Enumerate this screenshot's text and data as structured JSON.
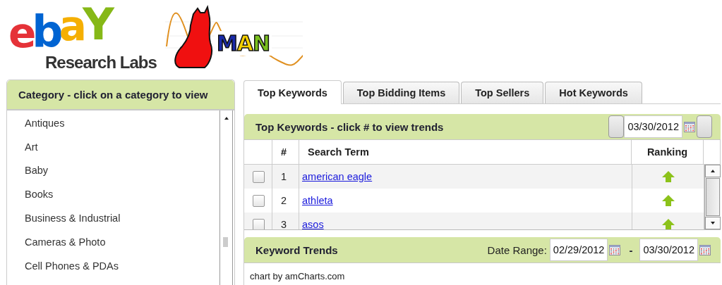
{
  "logos": {
    "ebay_letters": [
      "e",
      "b",
      "a",
      "Y"
    ],
    "ebay_subtitle": "Research Labs",
    "man_letters": [
      "M",
      "A",
      "N"
    ]
  },
  "category_panel": {
    "title": "Category - click on a category to view",
    "items": [
      {
        "label": "Antiques",
        "selected": false
      },
      {
        "label": "Art",
        "selected": false
      },
      {
        "label": "Baby",
        "selected": false
      },
      {
        "label": "Books",
        "selected": false
      },
      {
        "label": "Business & Industrial",
        "selected": false
      },
      {
        "label": "Cameras & Photo",
        "selected": false
      },
      {
        "label": "Cell Phones & PDAs",
        "selected": false
      }
    ]
  },
  "tabs": [
    {
      "label": "Top Keywords",
      "selected": true
    },
    {
      "label": "Top Bidding Items",
      "selected": false
    },
    {
      "label": "Top Sellers",
      "selected": false
    },
    {
      "label": "Hot Keywords",
      "selected": false
    }
  ],
  "keywords_panel": {
    "title": "Top Keywords - click # to view trends",
    "date": "03/30/2012",
    "table": {
      "columns": [
        "#",
        "Search Term",
        "Ranking"
      ],
      "rows": [
        {
          "checked": false,
          "rank": "1",
          "term": "american eagle"
        },
        {
          "checked": false,
          "rank": "2",
          "term": "athleta"
        },
        {
          "checked": false,
          "rank": "3",
          "term": "asos"
        }
      ]
    }
  },
  "trends_panel": {
    "title": "Keyword Trends",
    "date_range_label": "Date Range:",
    "date_from": "02/29/2012",
    "separator": "-",
    "date_to": "03/30/2012",
    "chart_credit": "chart by amCharts.com"
  }
}
